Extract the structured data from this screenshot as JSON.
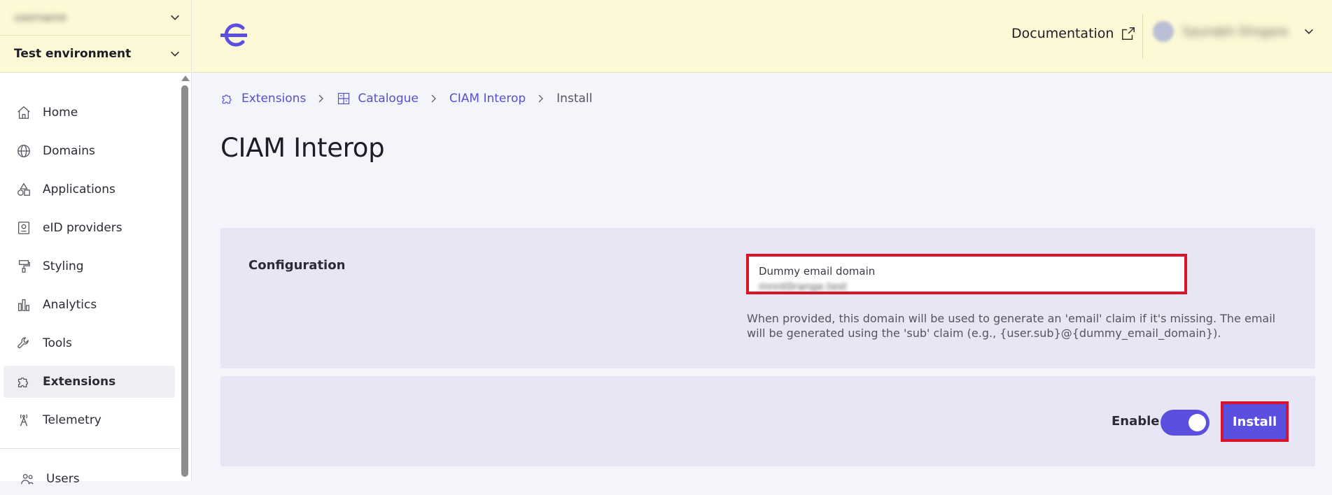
{
  "sidebar": {
    "org_selector": {
      "value": "username"
    },
    "environment_selector": {
      "value": "Test environment"
    },
    "items": [
      {
        "label": "Home",
        "icon": "home-icon"
      },
      {
        "label": "Domains",
        "icon": "globe-icon"
      },
      {
        "label": "Applications",
        "icon": "shapes-icon"
      },
      {
        "label": "eID providers",
        "icon": "id-card-icon"
      },
      {
        "label": "Styling",
        "icon": "paint-roller-icon"
      },
      {
        "label": "Analytics",
        "icon": "bar-chart-icon"
      },
      {
        "label": "Tools",
        "icon": "wrench-icon"
      },
      {
        "label": "Extensions",
        "icon": "puzzle-icon",
        "active": true
      },
      {
        "label": "Telemetry",
        "icon": "antenna-icon"
      },
      {
        "label": "Users",
        "icon": "users-icon"
      }
    ]
  },
  "header": {
    "documentation_label": "Documentation",
    "user_name": "Saurabh Dingare"
  },
  "breadcrumb": [
    {
      "label": "Extensions",
      "icon": "puzzle-icon"
    },
    {
      "label": "Catalogue",
      "icon": "catalogue-icon"
    },
    {
      "label": "CIAM Interop"
    },
    {
      "label": "Install"
    }
  ],
  "page": {
    "title": "CIAM Interop"
  },
  "configuration": {
    "section_label": "Configuration",
    "field": {
      "label": "Dummy email domain",
      "value": "mnnt0range.test",
      "help": "When provided, this domain will be used to generate an 'email' claim if it's missing. The email will be generated using the 'sub' claim (e.g., {user.sub}@{dummy_email_domain})."
    }
  },
  "actions": {
    "enable_label": "Enable",
    "enabled": true,
    "install_label": "Install"
  },
  "colors": {
    "accent": "#5b4fe0",
    "header_bg": "#fdf9d6",
    "highlight": "#d8132a",
    "panel_bg": "#e6e6f5"
  }
}
